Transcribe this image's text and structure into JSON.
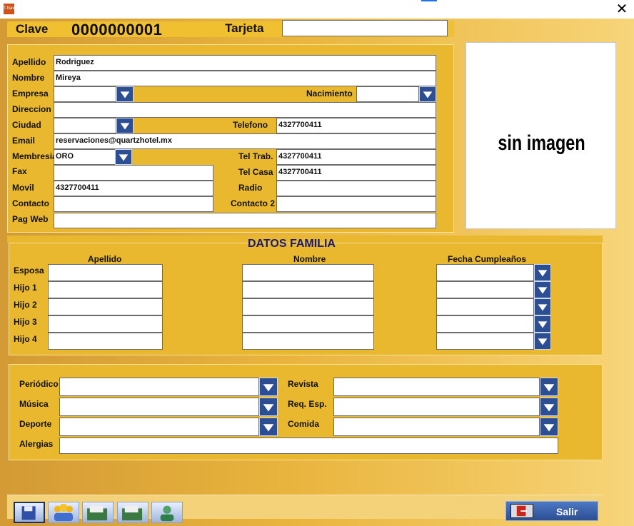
{
  "window": {
    "app_icon_text": "T.Navi",
    "close_glyph": "✕",
    "accent_color": "#1e73e8"
  },
  "header": {
    "clave_label": "Clave",
    "clave_value": "0000000001",
    "tarjeta_label": "Tarjeta",
    "tarjeta_value": ""
  },
  "guest": {
    "apellido_label": "Apellido",
    "apellido_value": "Rodriguez",
    "nombre_label": "Nombre",
    "nombre_value": "Mireya",
    "empresa_label": "Empresa",
    "empresa_value": "",
    "nacimiento_label": "Nacimiento",
    "nacimiento_value": "",
    "direccion_label": "Direccion",
    "direccion_value": "",
    "ciudad_label": "Ciudad",
    "ciudad_value": "",
    "telefono_label": "Telefono",
    "telefono_value": "4327700411",
    "email_label": "Email",
    "email_value": "reservaciones@quartzhotel.mx",
    "membresia_label": "Membresia",
    "membresia_value": "ORO",
    "teltrab_label": "Tel Trab.",
    "teltrab_value": "4327700411",
    "fax_label": "Fax",
    "fax_value": "",
    "telcasa_label": "Tel Casa",
    "telcasa_value": "4327700411",
    "movil_label": "Movil",
    "movil_value": "4327700411",
    "radio_label": "Radio",
    "radio_value": "",
    "contacto_label": "Contacto",
    "contacto_value": "",
    "contacto2_label": "Contacto 2",
    "contacto2_value": "",
    "pagweb_label": "Pag Web",
    "pagweb_value": ""
  },
  "photo": {
    "text": "sin imagen"
  },
  "family": {
    "title": "DATOS FAMILIA",
    "col_apellido": "Apellido",
    "col_nombre": "Nombre",
    "col_fecha": "Fecha Cumpleaños",
    "rows": [
      {
        "label": "Esposa",
        "apellido": "",
        "nombre": "",
        "fecha": ""
      },
      {
        "label": "Hijo 1",
        "apellido": "",
        "nombre": "",
        "fecha": ""
      },
      {
        "label": "Hijo 2",
        "apellido": "",
        "nombre": "",
        "fecha": ""
      },
      {
        "label": "Hijo 3",
        "apellido": "",
        "nombre": "",
        "fecha": ""
      },
      {
        "label": "Hijo 4",
        "apellido": "",
        "nombre": "",
        "fecha": ""
      }
    ]
  },
  "prefs": {
    "periodico_label": "Periódico",
    "periodico_value": "",
    "revista_label": "Revista",
    "revista_value": "",
    "musica_label": "Música",
    "musica_value": "",
    "reqesp_label": "Req. Esp.",
    "reqesp_value": "",
    "deporte_label": "Deporte",
    "deporte_value": "",
    "comida_label": "Comida",
    "comida_value": "",
    "alergias_label": "Alergias",
    "alergias_value": ""
  },
  "toolbar": {
    "salir_label": "Salir"
  }
}
